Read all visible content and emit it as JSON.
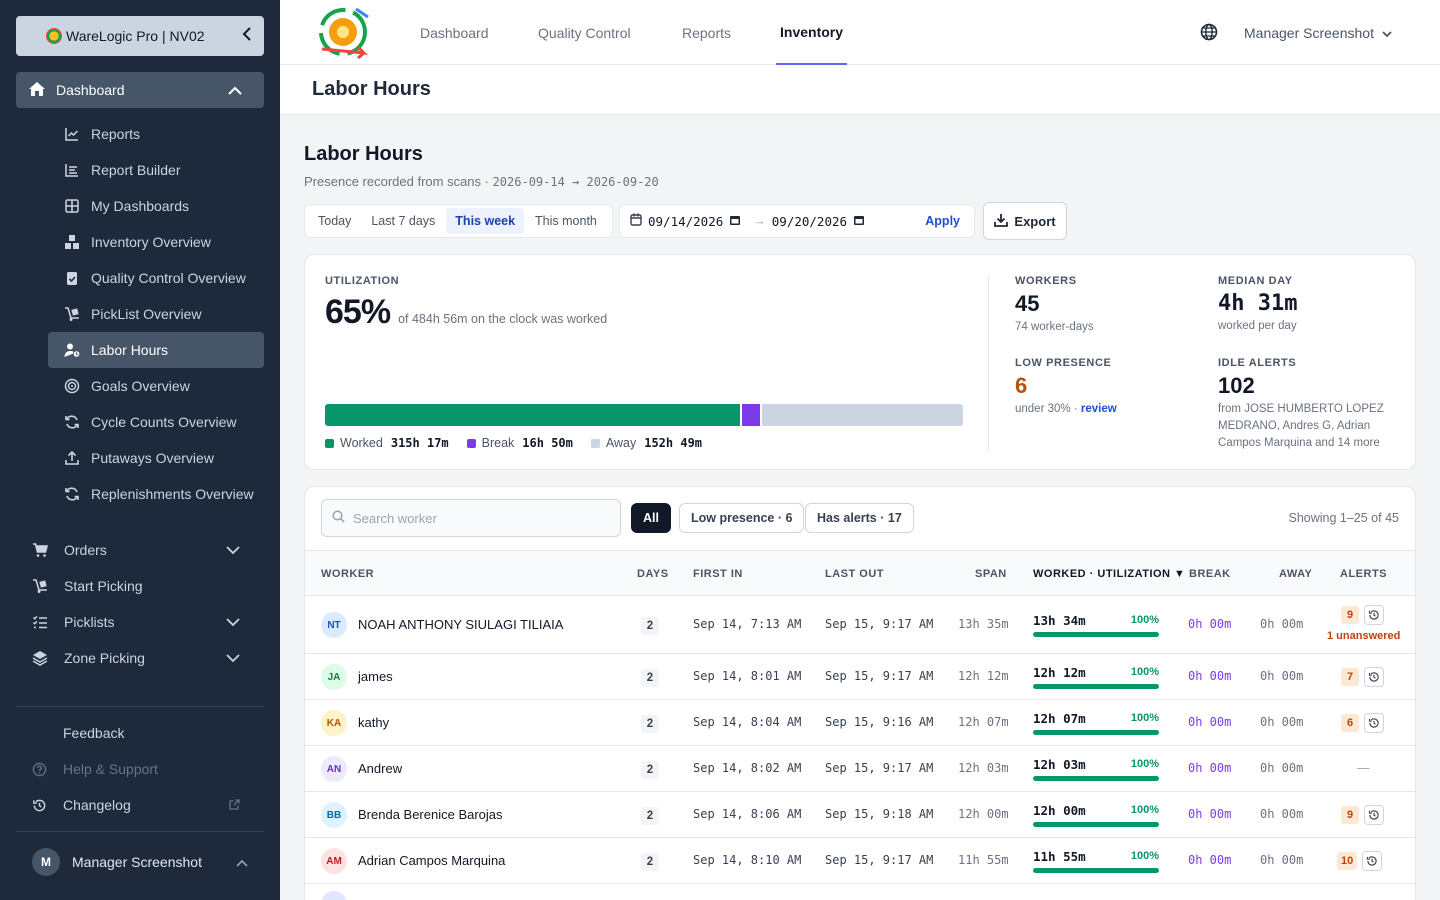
{
  "sidebar": {
    "org": "WareLogic Pro | NV02",
    "top_item": "Dashboard",
    "sub_items": [
      {
        "label": "Reports",
        "icon": "chart-line-icon"
      },
      {
        "label": "Report Builder",
        "icon": "report-builder-icon"
      },
      {
        "label": "My Dashboards",
        "icon": "grid-icon"
      },
      {
        "label": "Inventory Overview",
        "icon": "boxes-icon"
      },
      {
        "label": "Quality Control Overview",
        "icon": "clipboard-check-icon"
      },
      {
        "label": "PickList Overview",
        "icon": "dolly-icon"
      },
      {
        "label": "Labor Hours",
        "icon": "user-clock-icon"
      },
      {
        "label": "Goals Overview",
        "icon": "target-icon"
      },
      {
        "label": "Cycle Counts Overview",
        "icon": "refresh-icon"
      },
      {
        "label": "Putaways Overview",
        "icon": "upload-icon"
      },
      {
        "label": "Replenishments Overview",
        "icon": "refresh-icon"
      }
    ],
    "main_items": [
      {
        "label": "Orders",
        "icon": "cart-icon",
        "expandable": true
      },
      {
        "label": "Start Picking",
        "icon": "dolly-icon",
        "expandable": false
      },
      {
        "label": "Picklists",
        "icon": "list-check-icon",
        "expandable": true
      },
      {
        "label": "Zone Picking",
        "icon": "layers-icon",
        "expandable": true
      }
    ],
    "footer_items": [
      {
        "label": "Feedback",
        "icon": "chat-icon"
      },
      {
        "label": "Help & Support",
        "icon": "help-icon"
      },
      {
        "label": "Changelog",
        "icon": "history-icon"
      }
    ],
    "user_initial": "M",
    "user_name": "Manager Screenshot"
  },
  "topnav": {
    "tabs": [
      "Dashboard",
      "Quality Control",
      "Reports",
      "Inventory"
    ],
    "active_tab": "Inventory",
    "user_menu": "Manager Screenshot"
  },
  "page": {
    "header_title": "Labor Hours",
    "title": "Labor Hours",
    "subtitle_prefix": "Presence recorded from scans · ",
    "date_range_text": "2026-09-14 → 2026-09-20",
    "ranges": [
      "Today",
      "Last 7 days",
      "This week",
      "This month"
    ],
    "active_range": "This week",
    "date_from": "09/14/2026",
    "date_to": "09/20/2026",
    "apply_label": "Apply",
    "export_label": "Export"
  },
  "stats": {
    "utilization_label": "UTILIZATION",
    "utilization_value": "65%",
    "utilization_note": "of 484h 56m on the clock was worked",
    "bar": {
      "worked_fraction": 0.651,
      "break_fraction": 0.035,
      "away_fraction": 0.314
    },
    "legend": [
      {
        "label": "Worked",
        "value": "315h 17m",
        "color": "#059669"
      },
      {
        "label": "Break",
        "value": "16h 50m",
        "color": "#7c3aed"
      },
      {
        "label": "Away",
        "value": "152h 49m",
        "color": "#cbd5e1"
      }
    ],
    "workers_label": "WORKERS",
    "workers_value": "45",
    "workers_note": "74 worker-days",
    "median_label": "MEDIAN DAY",
    "median_value": "4h 31m",
    "median_note": "worked per day",
    "low_label": "LOW PRESENCE",
    "low_value": "6",
    "low_note": "under 30% · ",
    "low_link": "review",
    "idle_label": "IDLE ALERTS",
    "idle_value": "102",
    "idle_note": "from JOSE HUMBERTO LOPEZ MEDRANO, Andres G, Adrian Campos Marquina and 14 more"
  },
  "table": {
    "search_placeholder": "Search worker",
    "filters": [
      "All",
      "Low presence · 6",
      "Has alerts · 17"
    ],
    "active_filter": "All",
    "showing": "Showing 1–25 of 45",
    "columns": [
      "WORKER",
      "DAYS",
      "FIRST IN",
      "LAST OUT",
      "SPAN",
      "WORKED · UTILIZATION ▼",
      "BREAK",
      "AWAY",
      "ALERTS"
    ],
    "rows": [
      {
        "initials": "NT",
        "avatar_bg": "#dbeafe",
        "avatar_fg": "#1d4ed8",
        "name": "NOAH ANTHONY SIULAGI TILIAIA",
        "days": "2",
        "first_in": "Sep 14, 7:13 AM",
        "last_out": "Sep 15, 9:17 AM",
        "span": "13h 35m",
        "worked": "13h 34m",
        "util": "100%",
        "util_fraction": 1,
        "break": "0h 00m",
        "away": "0h 00m",
        "alerts": "9",
        "note": "1 unanswered"
      },
      {
        "initials": "JA",
        "avatar_bg": "#dcfce7",
        "avatar_fg": "#15803d",
        "name": "james",
        "days": "2",
        "first_in": "Sep 14, 8:01 AM",
        "last_out": "Sep 15, 9:17 AM",
        "span": "12h 12m",
        "worked": "12h 12m",
        "util": "100%",
        "util_fraction": 1,
        "break": "0h 00m",
        "away": "0h 00m",
        "alerts": "7",
        "note": ""
      },
      {
        "initials": "KA",
        "avatar_bg": "#fef3c7",
        "avatar_fg": "#b45309",
        "name": "kathy",
        "days": "2",
        "first_in": "Sep 14, 8:04 AM",
        "last_out": "Sep 15, 9:16 AM",
        "span": "12h 07m",
        "worked": "12h 07m",
        "util": "100%",
        "util_fraction": 1,
        "break": "0h 00m",
        "away": "0h 00m",
        "alerts": "6",
        "note": ""
      },
      {
        "initials": "AN",
        "avatar_bg": "#ede9fe",
        "avatar_fg": "#6d28d9",
        "name": "Andrew",
        "days": "2",
        "first_in": "Sep 14, 8:02 AM",
        "last_out": "Sep 15, 9:17 AM",
        "span": "12h 03m",
        "worked": "12h 03m",
        "util": "100%",
        "util_fraction": 1,
        "break": "0h 00m",
        "away": "0h 00m",
        "alerts": "—",
        "note": ""
      },
      {
        "initials": "BB",
        "avatar_bg": "#e0f2fe",
        "avatar_fg": "#0369a1",
        "name": "Brenda Berenice Barojas",
        "days": "2",
        "first_in": "Sep 14, 8:06 AM",
        "last_out": "Sep 15, 9:18 AM",
        "span": "12h 00m",
        "worked": "12h 00m",
        "util": "100%",
        "util_fraction": 1,
        "break": "0h 00m",
        "away": "0h 00m",
        "alerts": "9",
        "note": ""
      },
      {
        "initials": "AM",
        "avatar_bg": "#fee2e2",
        "avatar_fg": "#b91c1c",
        "name": "Adrian Campos Marquina",
        "days": "2",
        "first_in": "Sep 14, 8:10 AM",
        "last_out": "Sep 15, 9:17 AM",
        "span": "11h 55m",
        "worked": "11h 55m",
        "util": "100%",
        "util_fraction": 1,
        "break": "0h 00m",
        "away": "0h 00m",
        "alerts": "10",
        "note": ""
      }
    ]
  }
}
